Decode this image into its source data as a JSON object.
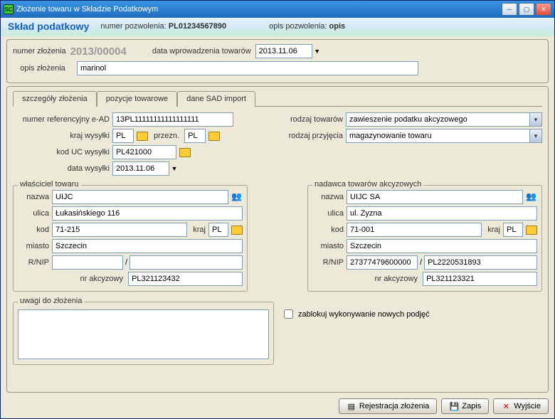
{
  "window": {
    "title": "Złożenie towaru w Składzie Podatkowym",
    "icon_text": "SC"
  },
  "header": {
    "title": "Skład podatkowy",
    "permit_label": "numer pozwolenia:",
    "permit_value": "PL01234567890",
    "desc_label": "opis pozwolenia:",
    "desc_value": "opis"
  },
  "top": {
    "deposit_no_label": "numer złożenia",
    "deposit_no": "2013/00004",
    "date_label": "data wprowadzenia towarów",
    "date_value": "2013.11.06",
    "desc_label": "opis złożenia",
    "desc_value": "marinol"
  },
  "tabs": {
    "t1": "szczegóły złożenia",
    "t2": "pozycje towarowe",
    "t3": "dane SAD import"
  },
  "form": {
    "ead_ref_label": "numer referencyjny e-AD",
    "ead_ref": "13PL11111111111111111",
    "ship_country_label": "kraj wysyłki",
    "ship_country": "PL",
    "dest_label": "przezn.",
    "dest": "PL",
    "uc_label": "kod UC wysyłki",
    "uc": "PL421000",
    "ship_date_label": "data wysyłki",
    "ship_date": "2013.11.06",
    "goods_type_label": "rodzaj towarów",
    "goods_type": "zawieszenie podatku akcyzowego",
    "accept_type_label": "rodzaj przyjęcia",
    "accept_type": "magazynowanie towaru"
  },
  "owner": {
    "legend": "właściciel towaru",
    "name_label": "nazwa",
    "name": "UIJC",
    "street_label": "ulica",
    "street": "Łukasińskiego 116",
    "postcode_label": "kod",
    "postcode": "71-215",
    "country_label": "kraj",
    "country": "PL",
    "city_label": "miasto",
    "city": "Szczecin",
    "rnip_label": "R/NIP",
    "rnip1": "",
    "rnip2": "",
    "excise_label": "nr akcyzowy",
    "excise": "PL321123432"
  },
  "sender": {
    "legend": "nadawca towarów akcyzowych",
    "name_label": "nazwa",
    "name": "UIJC SA",
    "street_label": "ulica",
    "street": "ul. Żyzna",
    "postcode_label": "kod",
    "postcode": "71-001",
    "country_label": "kraj",
    "country": "PL",
    "city_label": "miasto",
    "city": "Szczecin",
    "rnip_label": "R/NIP",
    "rnip1": "27377479600000",
    "rnip2": "PL2220531893",
    "excise_label": "nr akcyzowy",
    "excise": "PL321123321"
  },
  "remarks": {
    "label": "uwagi do złożenia",
    "value": ""
  },
  "lock": {
    "label": "zablokuj wykonywanie nowych podjęć"
  },
  "buttons": {
    "register": "Rejestracja złożenia",
    "save": "Zapis",
    "exit": "Wyjście"
  }
}
